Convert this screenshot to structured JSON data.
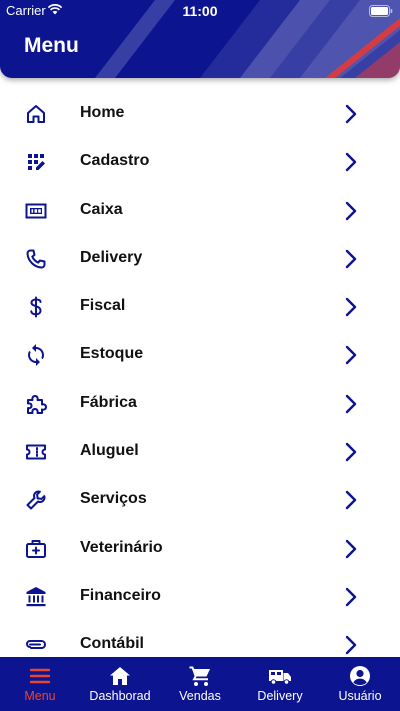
{
  "status_bar": {
    "carrier": "Carrier",
    "time": "11:00"
  },
  "header": {
    "title": "Menu"
  },
  "colors": {
    "primary": "#0c1490",
    "accent": "#e8472f",
    "text": "#111111"
  },
  "menu": {
    "items": [
      {
        "label": "Home",
        "icon": "home-icon"
      },
      {
        "label": "Cadastro",
        "icon": "grid-edit-icon"
      },
      {
        "label": "Caixa",
        "icon": "cash-register-icon"
      },
      {
        "label": "Delivery",
        "icon": "phone-icon"
      },
      {
        "label": "Fiscal",
        "icon": "dollar-icon"
      },
      {
        "label": "Estoque",
        "icon": "sync-icon"
      },
      {
        "label": "Fábrica",
        "icon": "puzzle-icon"
      },
      {
        "label": "Aluguel",
        "icon": "ticket-icon"
      },
      {
        "label": "Serviços",
        "icon": "wrench-icon"
      },
      {
        "label": "Veterinário",
        "icon": "medical-kit-icon"
      },
      {
        "label": "Financeiro",
        "icon": "bank-icon"
      },
      {
        "label": "Contábil",
        "icon": "paperclip-icon"
      }
    ]
  },
  "bottom_nav": {
    "items": [
      {
        "label": "Menu",
        "icon": "menu-icon",
        "active": true
      },
      {
        "label": "Dashborad",
        "icon": "house-icon",
        "active": false
      },
      {
        "label": "Vendas",
        "icon": "cart-icon",
        "active": false
      },
      {
        "label": "Delivery",
        "icon": "truck-icon",
        "active": false
      },
      {
        "label": "Usuário",
        "icon": "user-icon",
        "active": false
      }
    ]
  }
}
